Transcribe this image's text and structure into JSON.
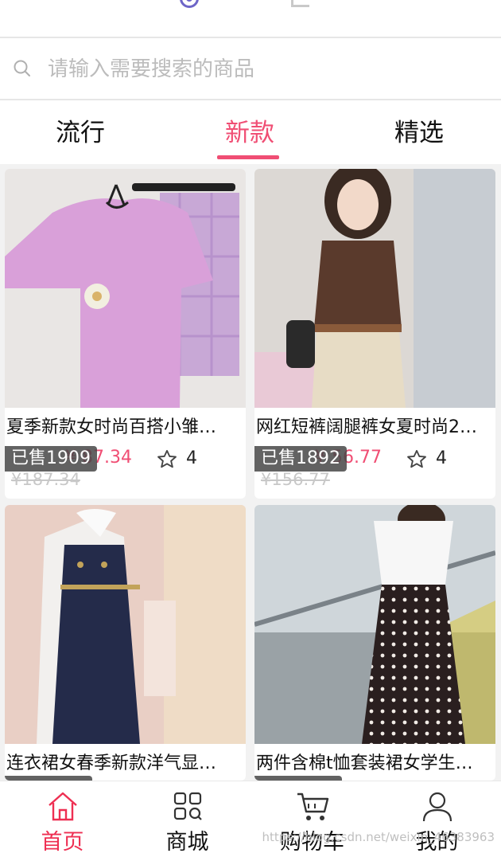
{
  "search": {
    "placeholder": "请输入需要搜索的商品"
  },
  "tabs": [
    {
      "label": "流行",
      "active": false
    },
    {
      "label": "新款",
      "active": true
    },
    {
      "label": "精选",
      "active": false
    }
  ],
  "products": [
    {
      "title": "夏季新款女时尚百搭小雏…",
      "sold": "已售1909",
      "price": "¥ 87.34",
      "orig_price": "¥187.34",
      "collect": "4"
    },
    {
      "title": "网红短裤阔腿裤女夏时尚2…",
      "sold": "已售1892",
      "price": "¥ 56.77",
      "orig_price": "¥156.77",
      "collect": "4"
    },
    {
      "title": "连衣裙女春季新款洋气显…",
      "sold": "",
      "price": "",
      "orig_price": "",
      "collect": ""
    },
    {
      "title": "两件含棉t恤套装裙女学生…",
      "sold": "",
      "price": "",
      "orig_price": "",
      "collect": ""
    }
  ],
  "tabbar": [
    {
      "label": "首页",
      "icon": "home-icon",
      "active": true
    },
    {
      "label": "商城",
      "icon": "category-icon",
      "active": false
    },
    {
      "label": "购物车",
      "icon": "cart-icon",
      "active": false
    },
    {
      "label": "我的",
      "icon": "user-icon",
      "active": false
    }
  ],
  "watermark": "https://blog.csdn.net/weixin_46383963",
  "colors": {
    "accent": "#f04e74",
    "tabbar_active": "#ee2f52",
    "sold_badge": "#464646"
  }
}
